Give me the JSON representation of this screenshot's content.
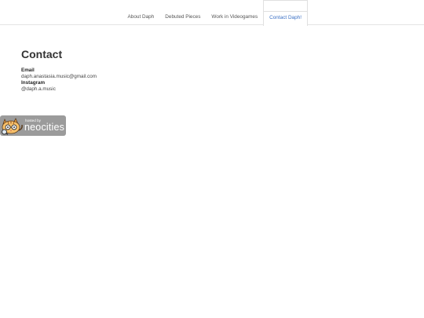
{
  "nav": {
    "items": [
      {
        "label": "About Daph"
      },
      {
        "label": "Debuted Pieces"
      },
      {
        "label": "Work in Videogames"
      },
      {
        "label": "Contact Daph!"
      }
    ],
    "active_index": 3,
    "active_color": "#3a6fc4"
  },
  "main": {
    "title": "Contact",
    "email_label": "Email",
    "email_value": "daph.anastasia.music@gmail.com",
    "instagram_label": "Instagram",
    "instagram_value": "@daph.a.music"
  },
  "badge": {
    "small_text": "hosted by",
    "big_text": "neocities",
    "icon": "neocities-cat-icon",
    "background": "#9b9b9b"
  }
}
